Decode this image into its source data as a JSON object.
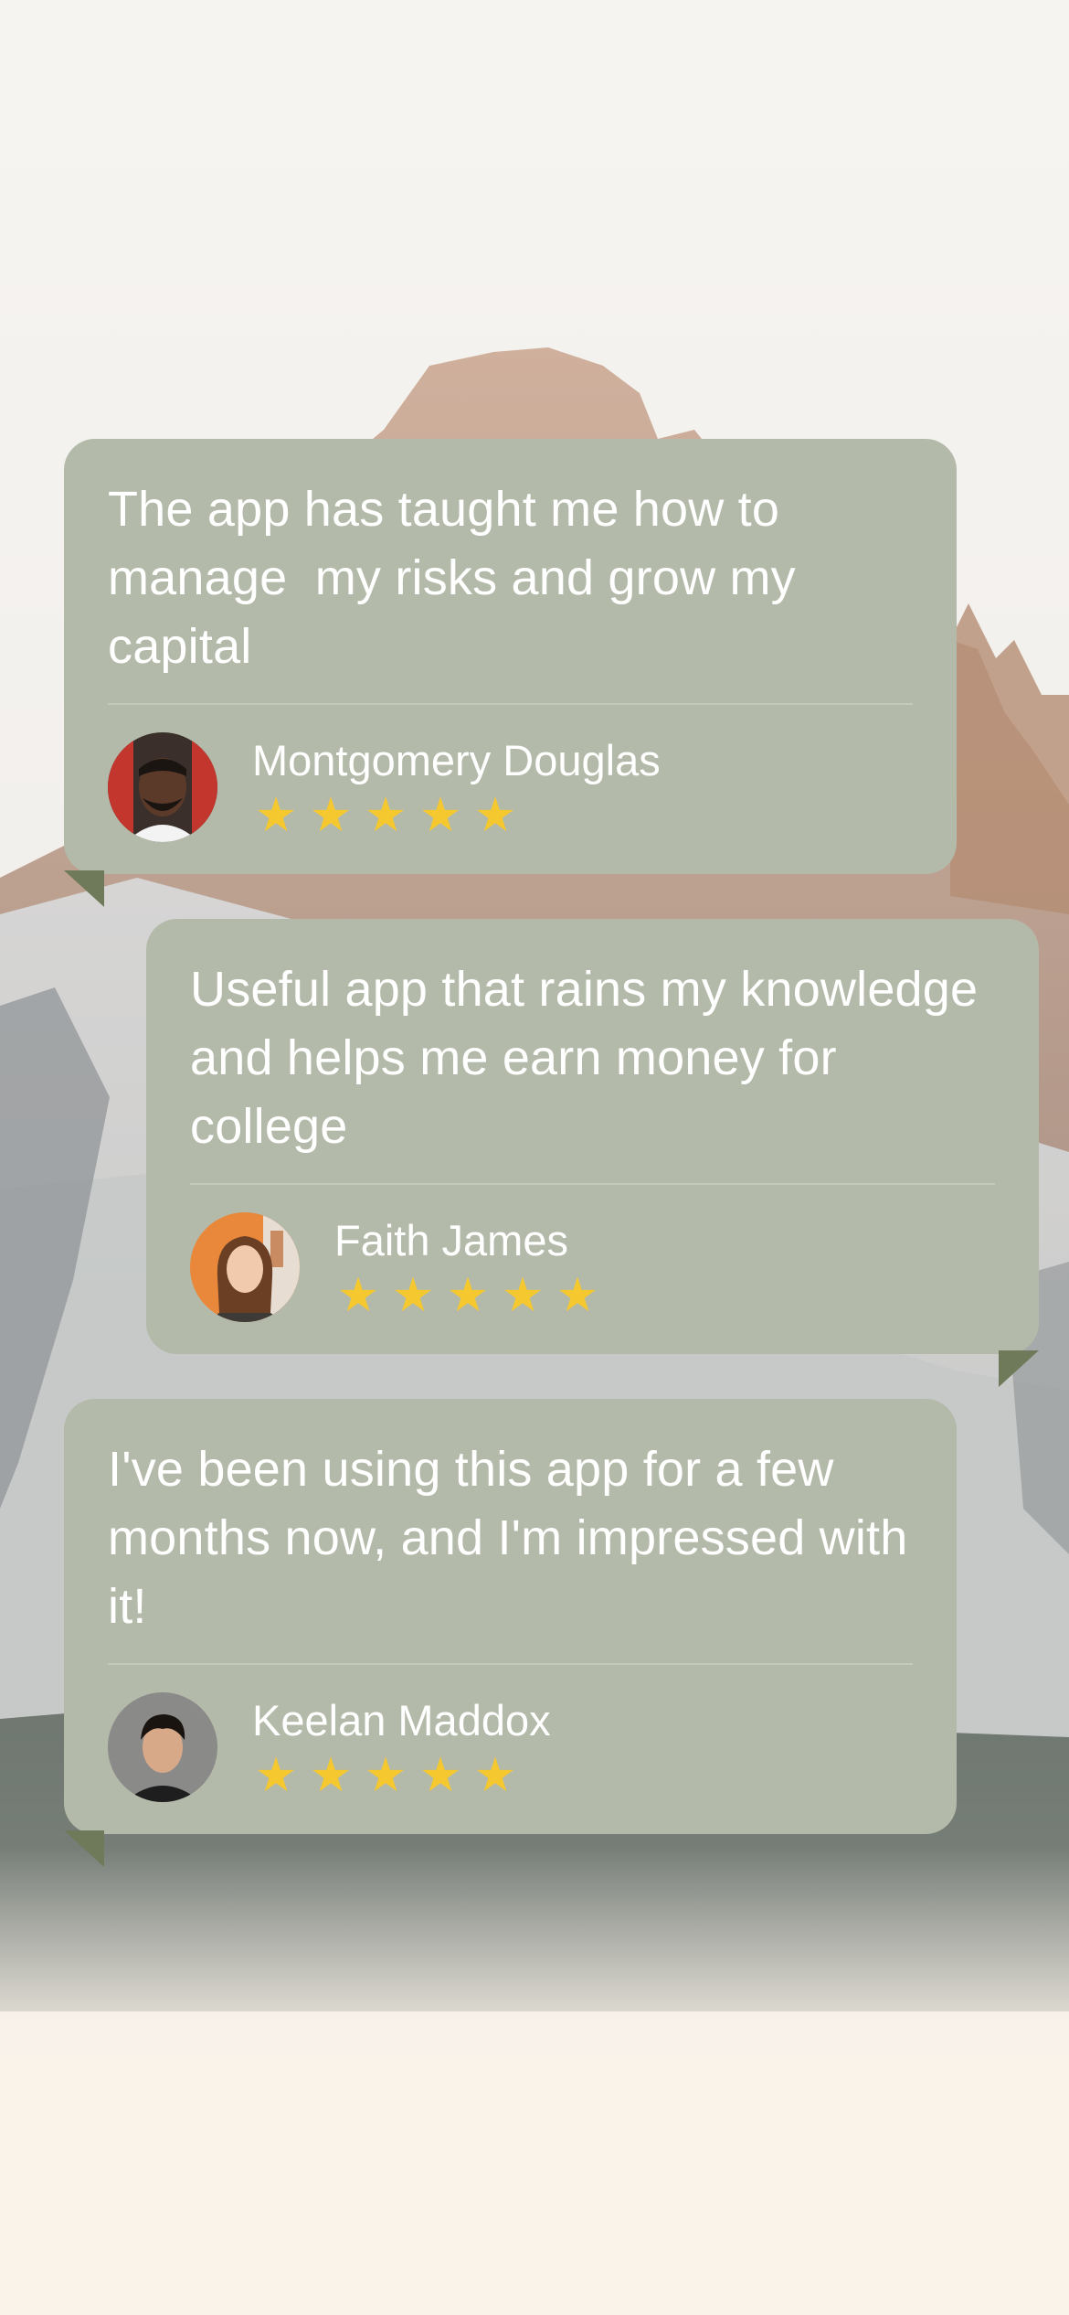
{
  "colors": {
    "card_background": "#b4baa9",
    "star": "#f6c830",
    "text": "#ffffff",
    "page_background": "#faf3ea"
  },
  "icons": {
    "star": "★"
  },
  "testimonials": [
    {
      "quote": "The app has taught me how to manage  my risks and grow my capital",
      "author": "Montgomery Douglas",
      "rating": 5
    },
    {
      "quote": "Useful app that rains my knowledge and helps me earn money for college",
      "author": "Faith James",
      "rating": 5
    },
    {
      "quote": "I've been using this app for a few months now, and I'm impressed with it!",
      "author": "Keelan Maddox",
      "rating": 5
    }
  ]
}
